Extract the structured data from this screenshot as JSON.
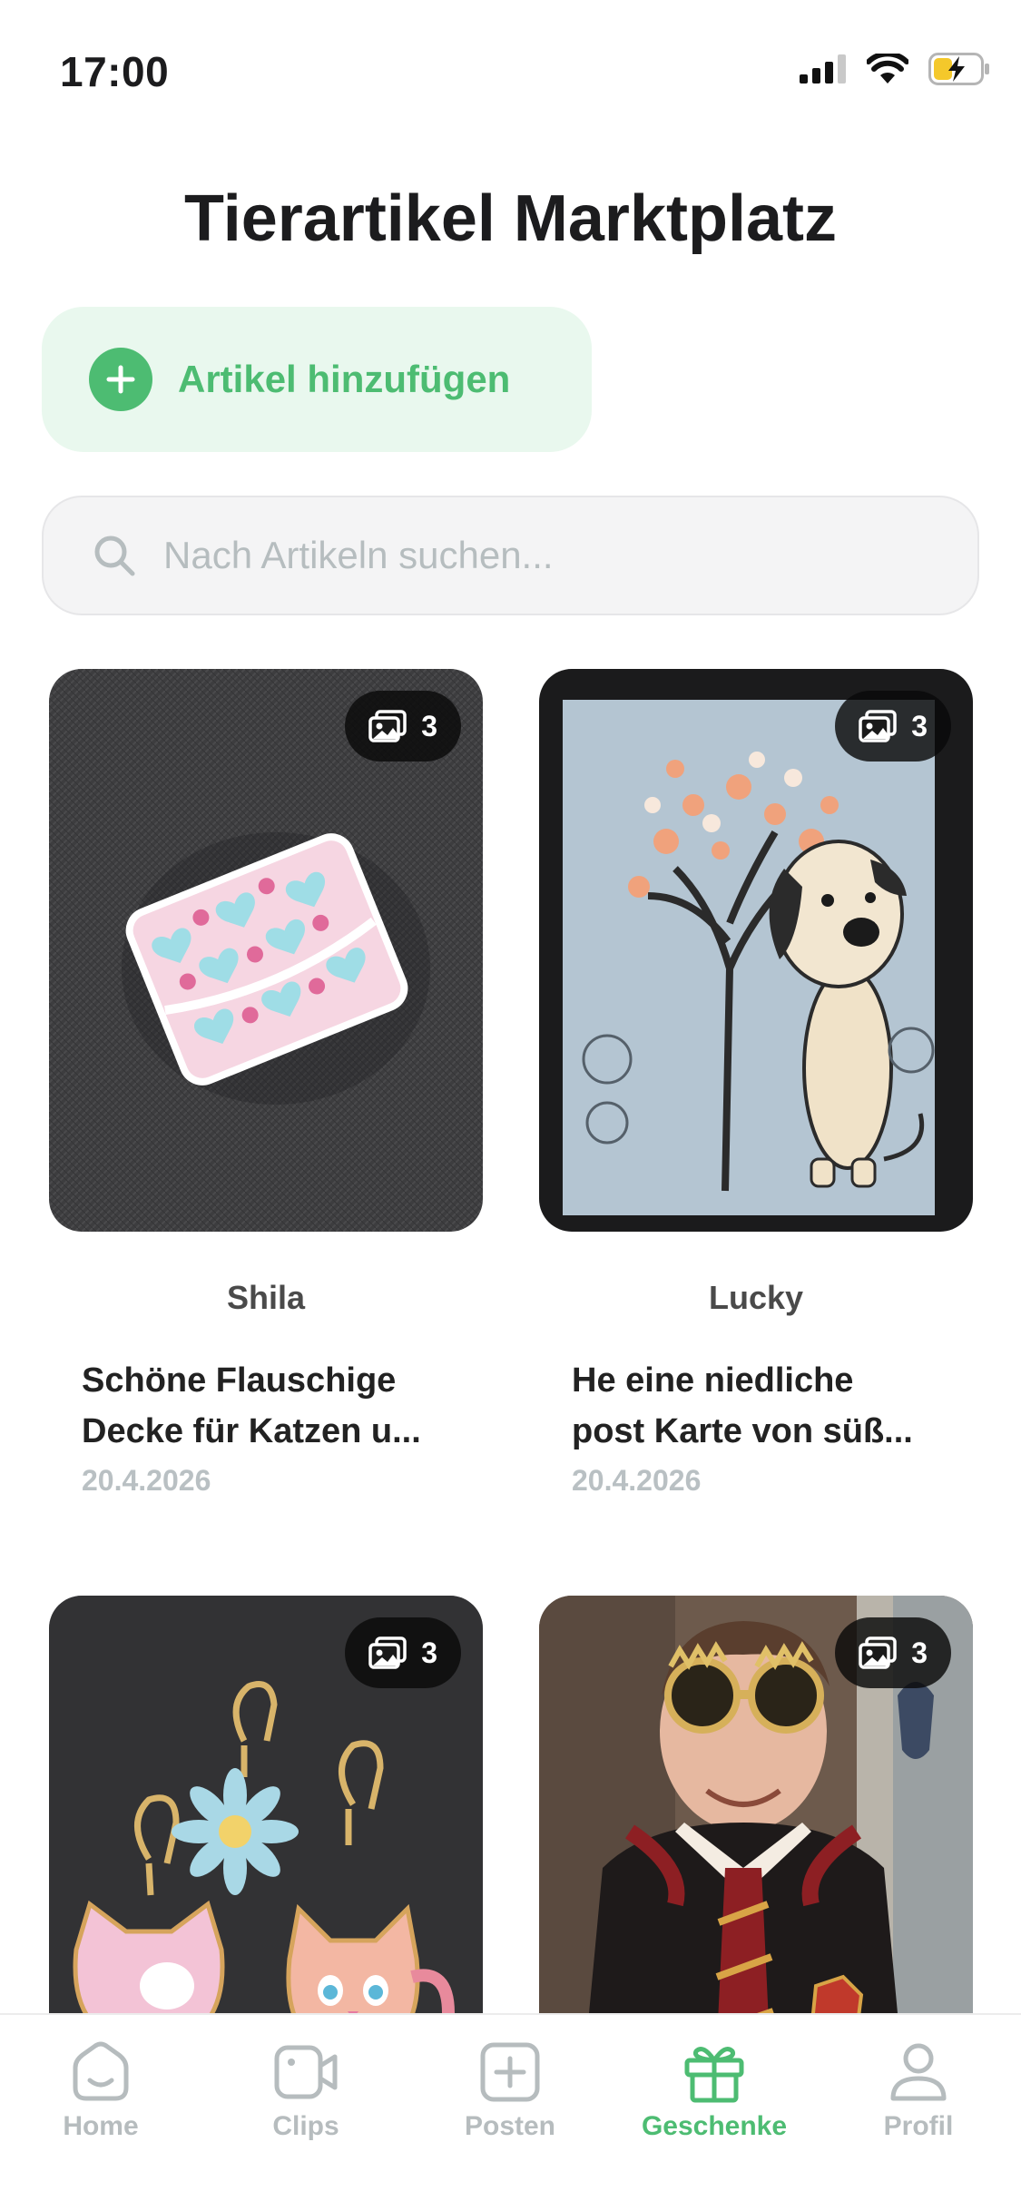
{
  "status_bar": {
    "time": "17:00"
  },
  "page_title": "Tierartikel Marktplatz",
  "add_button": {
    "label": "Artikel hinzufügen"
  },
  "search": {
    "placeholder": "Nach Artikeln suchen..."
  },
  "listings": [
    {
      "photo_count": "3",
      "seller": "Shila",
      "title_line1": "Schöne Flauschige",
      "title_line2": "Decke für Katzen u...",
      "date": "20.4.2026"
    },
    {
      "photo_count": "3",
      "seller": "Lucky",
      "title_line1": "He eine niedliche",
      "title_line2": "post Karte von süß...",
      "date": "20.4.2026"
    },
    {
      "photo_count": "3"
    },
    {
      "photo_count": "3"
    }
  ],
  "bottom_nav": {
    "items": [
      {
        "label": "Home",
        "icon": "home-icon",
        "active": false
      },
      {
        "label": "Clips",
        "icon": "video-icon",
        "active": false
      },
      {
        "label": "Posten",
        "icon": "plus-square-icon",
        "active": false
      },
      {
        "label": "Geschenke",
        "icon": "gift-icon",
        "active": true
      },
      {
        "label": "Profil",
        "icon": "person-icon",
        "active": false
      }
    ]
  },
  "colors": {
    "accent": "#4dbc72",
    "accent_light": "#e9f8ee",
    "muted": "#b6bcbe"
  }
}
